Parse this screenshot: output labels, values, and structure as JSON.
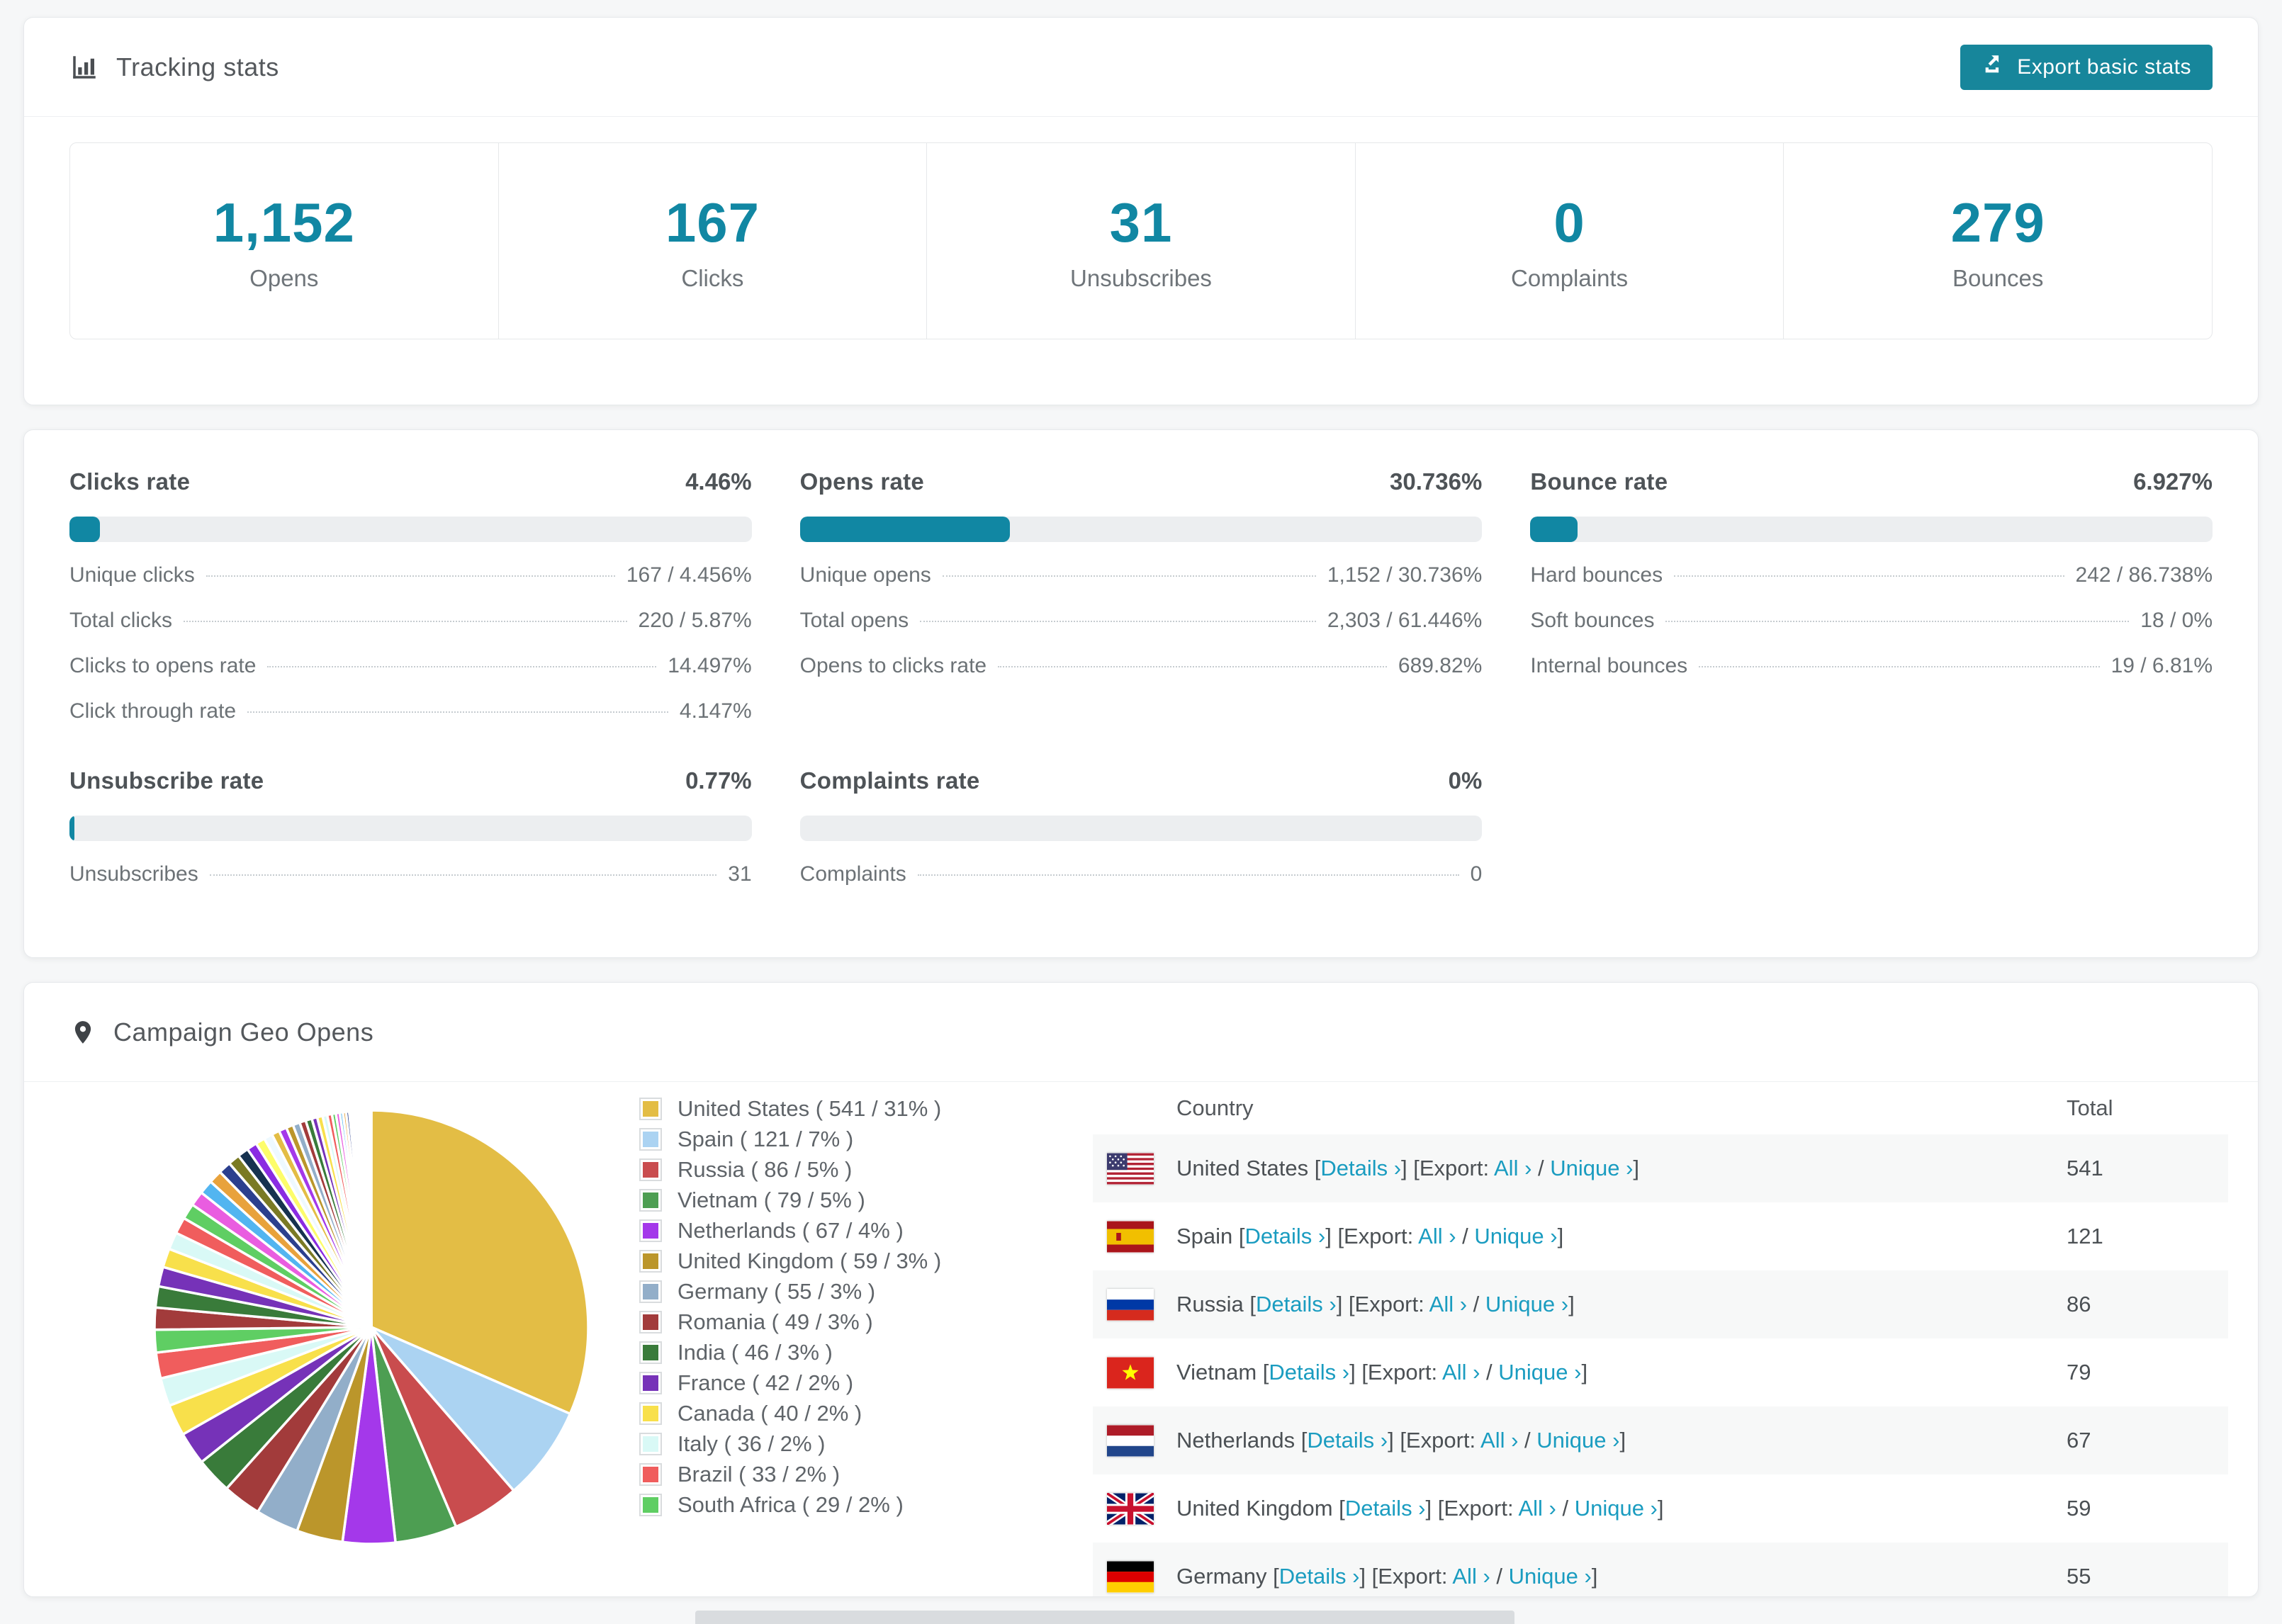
{
  "header": {
    "title": "Tracking stats",
    "export_label": "Export basic stats"
  },
  "summary_stats": [
    {
      "value": "1,152",
      "label": "Opens"
    },
    {
      "value": "167",
      "label": "Clicks"
    },
    {
      "value": "31",
      "label": "Unsubscribes"
    },
    {
      "value": "0",
      "label": "Complaints"
    },
    {
      "value": "279",
      "label": "Bounces"
    }
  ],
  "rates": [
    {
      "title": "Clicks rate",
      "value": "4.46%",
      "percent": 4.46,
      "row": 1,
      "rows": [
        {
          "label": "Unique clicks",
          "value": "167 / 4.456%"
        },
        {
          "label": "Total clicks",
          "value": "220 / 5.87%"
        },
        {
          "label": "Clicks to opens rate",
          "value": "14.497%"
        },
        {
          "label": "Click through rate",
          "value": "4.147%"
        }
      ]
    },
    {
      "title": "Opens rate",
      "value": "30.736%",
      "percent": 30.736,
      "row": 1,
      "rows": [
        {
          "label": "Unique opens",
          "value": "1,152 / 30.736%"
        },
        {
          "label": "Total opens",
          "value": "2,303 / 61.446%"
        },
        {
          "label": "Opens to clicks rate",
          "value": "689.82%"
        }
      ]
    },
    {
      "title": "Bounce rate",
      "value": "6.927%",
      "percent": 6.927,
      "row": 1,
      "rows": [
        {
          "label": "Hard bounces",
          "value": "242 / 86.738%"
        },
        {
          "label": "Soft bounces",
          "value": "18 / 0%"
        },
        {
          "label": "Internal bounces",
          "value": "19 / 6.81%"
        }
      ]
    },
    {
      "title": "Unsubscribe rate",
      "value": "0.77%",
      "percent": 0.77,
      "row": 2,
      "rows": [
        {
          "label": "Unsubscribes",
          "value": "31"
        }
      ]
    },
    {
      "title": "Complaints rate",
      "value": "0%",
      "percent": 0,
      "row": 2,
      "rows": [
        {
          "label": "Complaints",
          "value": "0"
        }
      ]
    }
  ],
  "geo": {
    "title": "Campaign Geo Opens",
    "legend_format": "{name} ( {value} / {pct} )",
    "table": {
      "columns": [
        "Country",
        "Total"
      ],
      "details_label": "Details ›",
      "export_prefix": "[Export: ",
      "all_label": "All ›",
      "unique_label": "Unique ›",
      "rows": [
        {
          "country": "United States",
          "flag": "us",
          "total": "541"
        },
        {
          "country": "Spain",
          "flag": "es",
          "total": "121"
        },
        {
          "country": "Russia",
          "flag": "ru",
          "total": "86"
        },
        {
          "country": "Vietnam",
          "flag": "vn",
          "total": "79"
        },
        {
          "country": "Netherlands",
          "flag": "nl",
          "total": "67"
        },
        {
          "country": "United Kingdom",
          "flag": "gb",
          "total": "59"
        },
        {
          "country": "Germany",
          "flag": "de",
          "total": "55"
        }
      ]
    }
  },
  "chart_data": {
    "type": "pie",
    "title": "Campaign Geo Opens",
    "legend_position": "right-of-pie",
    "start_angle_deg": -90,
    "direction": "clockwise",
    "series": [
      {
        "name": "United States",
        "value": 541,
        "pct": "31%",
        "color": "#e3bd45"
      },
      {
        "name": "Spain",
        "value": 121,
        "pct": "7%",
        "color": "#abd3f2"
      },
      {
        "name": "Russia",
        "value": 86,
        "pct": "5%",
        "color": "#c94c4e"
      },
      {
        "name": "Vietnam",
        "value": 79,
        "pct": "5%",
        "color": "#4d9e52"
      },
      {
        "name": "Netherlands",
        "value": 67,
        "pct": "4%",
        "color": "#a438ea"
      },
      {
        "name": "United Kingdom",
        "value": 59,
        "pct": "3%",
        "color": "#bb962b"
      },
      {
        "name": "Germany",
        "value": 55,
        "pct": "3%",
        "color": "#92aec9"
      },
      {
        "name": "Romania",
        "value": 49,
        "pct": "3%",
        "color": "#a23b3b"
      },
      {
        "name": "India",
        "value": 46,
        "pct": "3%",
        "color": "#397b3a"
      },
      {
        "name": "France",
        "value": 42,
        "pct": "2%",
        "color": "#7632b8"
      },
      {
        "name": "Canada",
        "value": 40,
        "pct": "2%",
        "color": "#f8e04b"
      },
      {
        "name": "Italy",
        "value": 36,
        "pct": "2%",
        "color": "#d9f9f6"
      },
      {
        "name": "Brazil",
        "value": 33,
        "pct": "2%",
        "color": "#f05d5d"
      },
      {
        "name": "South Africa",
        "value": 29,
        "pct": "2%",
        "color": "#5fce63"
      }
    ],
    "other_unlabeled_values": [
      28,
      27,
      25,
      24,
      22,
      21,
      20,
      19,
      18,
      17,
      16,
      15,
      14,
      13,
      12,
      11,
      10,
      10,
      9,
      9,
      8,
      8,
      7,
      7,
      6,
      6,
      5,
      5,
      4,
      4,
      4,
      3,
      3,
      3,
      2,
      2,
      2,
      2,
      2,
      1,
      1,
      1,
      1,
      1,
      1,
      1,
      1,
      1
    ],
    "other_palette": [
      "#e3bd45",
      "#a438ea",
      "#bb962b",
      "#92aec9",
      "#a23b3b",
      "#397b3a",
      "#7632b8",
      "#f8e04b",
      "#d9f9f6",
      "#f05d5d",
      "#5fce63",
      "#e95de0",
      "#52b5f0",
      "#e8a23c",
      "#2b3f8e",
      "#7a7a24",
      "#16324f",
      "#8a2be2",
      "#fdfd6a",
      "#eef9ff"
    ]
  },
  "colors": {
    "accent_teal": "#1187a3",
    "button_teal": "#17869b",
    "link_teal": "#1a9cc0",
    "progress_track": "#eceef0",
    "row_stripe": "#f7f8f8"
  }
}
